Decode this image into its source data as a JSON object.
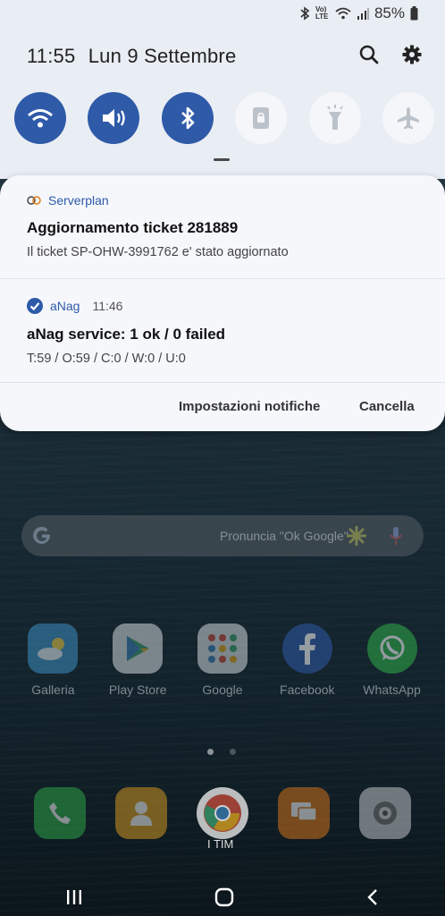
{
  "status": {
    "battery": "85%",
    "volte": "Vo) LTE"
  },
  "header": {
    "time": "11:55",
    "date": "Lun 9 Settembre"
  },
  "quick_settings": [
    {
      "name": "wifi",
      "on": true
    },
    {
      "name": "sound",
      "on": true
    },
    {
      "name": "bluetooth",
      "on": true
    },
    {
      "name": "rotation-lock",
      "on": false
    },
    {
      "name": "flashlight",
      "on": false
    },
    {
      "name": "airplane",
      "on": false
    }
  ],
  "notifications": [
    {
      "app": "Serverplan",
      "time": "",
      "title": "Aggiornamento ticket 281889",
      "body": "Il ticket SP-OHW-3991762 e' stato aggiornato"
    },
    {
      "app": "aNag",
      "time": "11:46",
      "title": "aNag service: 1 ok / 0 failed",
      "body": "T:59 / O:59 / C:0 / W:0 / U:0"
    }
  ],
  "shade_actions": {
    "settings": "Impostazioni notifiche",
    "clear": "Cancella"
  },
  "home": {
    "search_hint": "Pronuncia \"Ok Google\"",
    "apps": [
      "Galleria",
      "Play Store",
      "Google",
      "Facebook",
      "WhatsApp"
    ],
    "carrier": "I TIM"
  },
  "colors": {
    "accent": "#2e5aa8",
    "shade_bg": "#e9edf4",
    "card_bg": "#f5f7fb"
  }
}
